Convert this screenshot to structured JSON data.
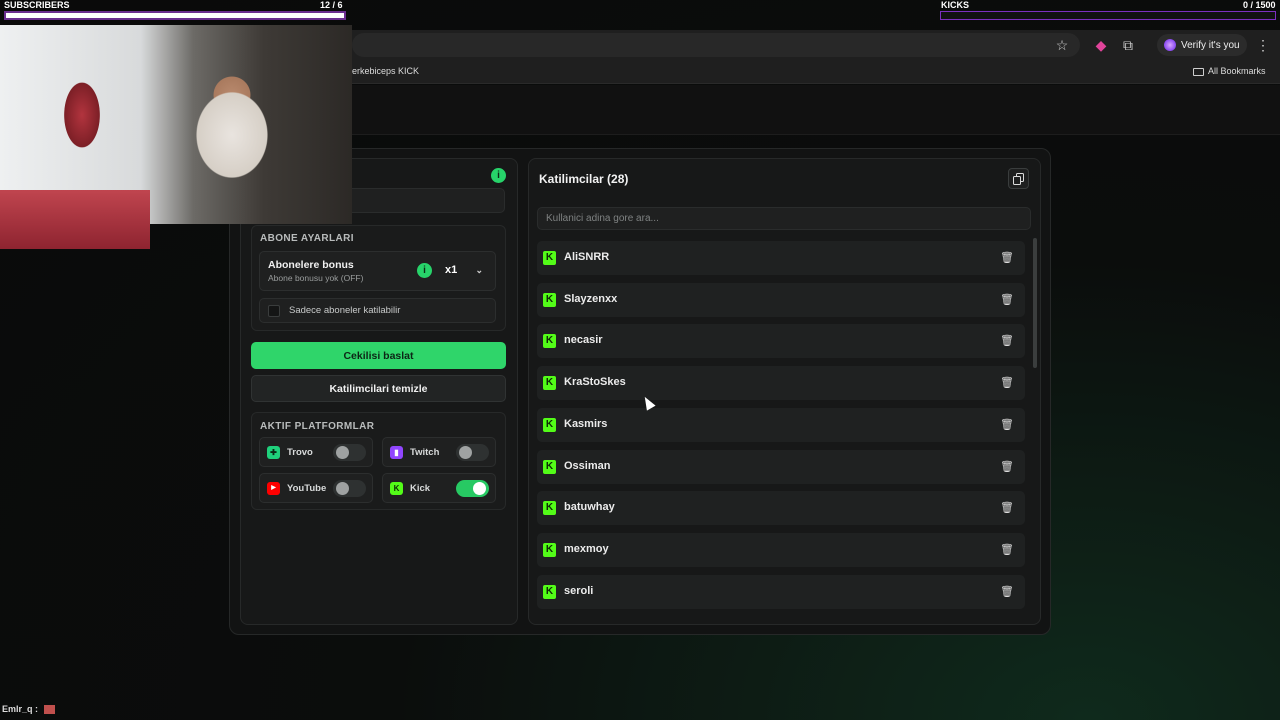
{
  "overlay": {
    "subscribers_label": "SUBSCRIBERS",
    "subscribers_count": "12 / 6",
    "kicks_label": "KICKS",
    "kicks_count": "0 / 1500",
    "chat_user": "Emlr_q :"
  },
  "browser": {
    "verify_label": "Verify it's you",
    "bookmark_text": "erkebiceps KICK",
    "all_bookmarks": "All Bookmarks"
  },
  "settings": {
    "subscriber_section_title": "ABONE AYARLARI",
    "bonus_title": "Abonelere bonus",
    "bonus_subtitle": "Abone bonusu yok (OFF)",
    "multiplier_value": "x1",
    "subscribers_only_label": "Sadece aboneler katilabilir",
    "start_button": "Cekilisi baslat",
    "clear_button": "Katilimcilari temizle",
    "platforms_title": "AKTIF PLATFORMLAR",
    "platforms": [
      {
        "name": "Trovo",
        "enabled": false,
        "color": "#1fd17c"
      },
      {
        "name": "Twitch",
        "enabled": false,
        "color": "#9146ff"
      },
      {
        "name": "YouTube",
        "enabled": false,
        "color": "#ff0000"
      },
      {
        "name": "Kick",
        "enabled": true,
        "color": "#53fc18"
      }
    ]
  },
  "participants": {
    "title": "Katilimcilar (28)",
    "search_placeholder": "Kullanici adina gore ara...",
    "list": [
      "AliSNRR",
      "Slayzenxx",
      "necasir",
      "KraStoSkes",
      "Kasmirs",
      "Ossiman",
      "batuwhay",
      "mexmoy",
      "seroli"
    ]
  },
  "colors": {
    "accent": "#2fd56a",
    "kick_green": "#53fc18"
  }
}
